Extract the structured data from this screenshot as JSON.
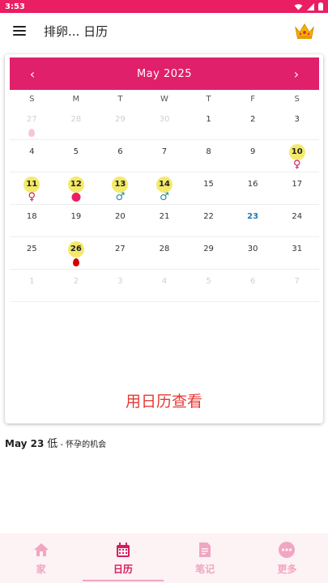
{
  "status_bar": {
    "time": "3:53"
  },
  "app_bar": {
    "title": "排卵... 日历"
  },
  "calendar": {
    "month_label": "May  2025",
    "prev_icon": "chevron-left-icon",
    "next_icon": "chevron-right-icon",
    "weekdays": [
      "S",
      "M",
      "T",
      "W",
      "T",
      "F",
      "S"
    ],
    "weeks": [
      [
        {
          "d": "27",
          "faded": true,
          "mark": "drop-light"
        },
        {
          "d": "28",
          "faded": true
        },
        {
          "d": "29",
          "faded": true
        },
        {
          "d": "30",
          "faded": true
        },
        {
          "d": "1"
        },
        {
          "d": "2"
        },
        {
          "d": "3"
        }
      ],
      [
        {
          "d": "4"
        },
        {
          "d": "5"
        },
        {
          "d": "6"
        },
        {
          "d": "7"
        },
        {
          "d": "8"
        },
        {
          "d": "9"
        },
        {
          "d": "10",
          "highlight": true,
          "mark": "female"
        }
      ],
      [
        {
          "d": "11",
          "highlight": true,
          "mark": "female"
        },
        {
          "d": "12",
          "highlight": true,
          "mark": "egg"
        },
        {
          "d": "13",
          "highlight": true,
          "mark": "male"
        },
        {
          "d": "14",
          "highlight": true,
          "mark": "male"
        },
        {
          "d": "15"
        },
        {
          "d": "16"
        },
        {
          "d": "17"
        }
      ],
      [
        {
          "d": "18"
        },
        {
          "d": "19"
        },
        {
          "d": "20"
        },
        {
          "d": "21"
        },
        {
          "d": "22"
        },
        {
          "d": "23",
          "today": true
        },
        {
          "d": "24"
        }
      ],
      [
        {
          "d": "25"
        },
        {
          "d": "26",
          "highlight": true,
          "mark": "drop"
        },
        {
          "d": "27"
        },
        {
          "d": "28"
        },
        {
          "d": "29"
        },
        {
          "d": "30"
        },
        {
          "d": "31"
        }
      ],
      [
        {
          "d": "1",
          "faded": true
        },
        {
          "d": "2",
          "faded": true
        },
        {
          "d": "3",
          "faded": true
        },
        {
          "d": "4",
          "faded": true
        },
        {
          "d": "5",
          "faded": true
        },
        {
          "d": "6",
          "faded": true
        },
        {
          "d": "7",
          "faded": true
        }
      ]
    ]
  },
  "banner": {
    "text": "用日历查看"
  },
  "info": {
    "date": "May 23",
    "level": "低",
    "desc": " - 怀孕的机会"
  },
  "nav": {
    "items": [
      {
        "label": "家",
        "icon": "home-icon",
        "active": false
      },
      {
        "label": "日历",
        "icon": "calendar-icon",
        "active": true
      },
      {
        "label": "笔记",
        "icon": "note-icon",
        "active": false
      },
      {
        "label": "更多",
        "icon": "more-icon",
        "active": false
      }
    ]
  },
  "colors": {
    "accent": "#e91e63",
    "header": "#e0206a",
    "highlight": "#f3ea6b",
    "today": "#1e7bb8",
    "banner_text": "#e53935",
    "nav_inactive": "#f0a6c3",
    "nav_active": "#d81b60"
  }
}
